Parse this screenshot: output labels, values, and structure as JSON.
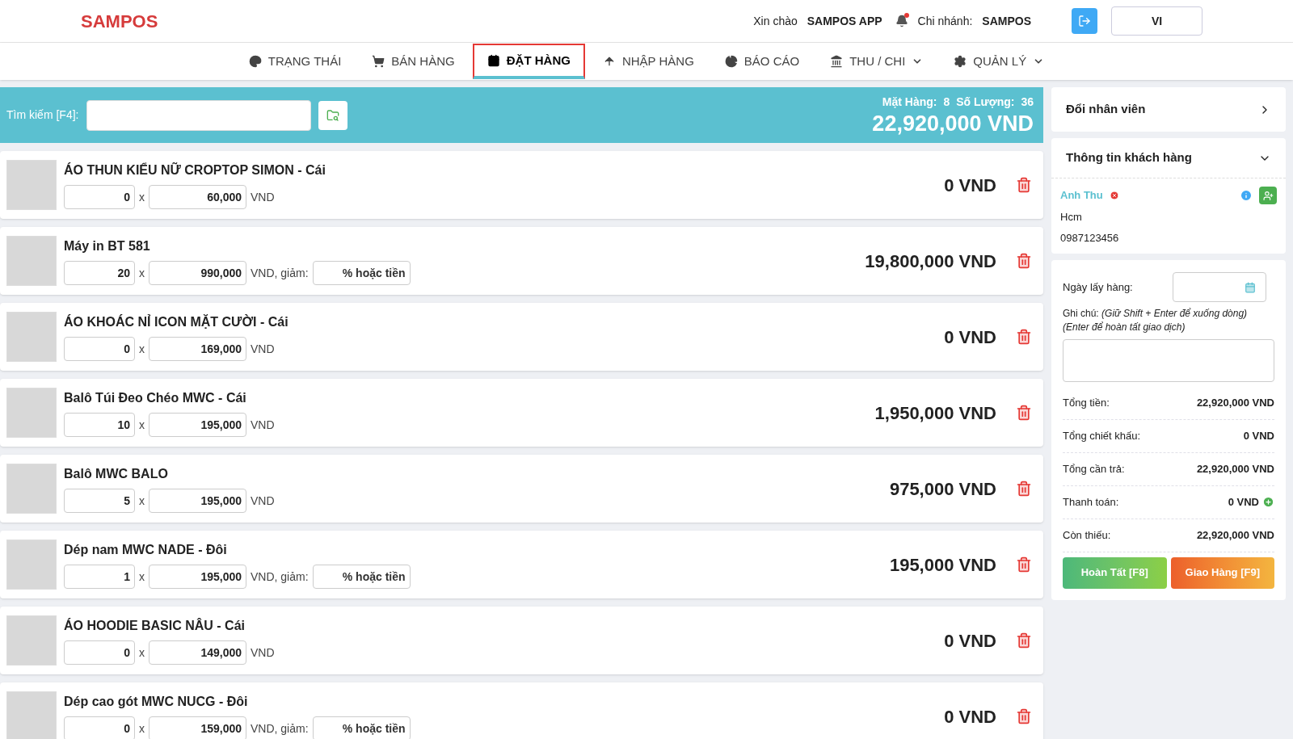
{
  "header": {
    "logo": "SAMPOS",
    "greeting": "Xin chào",
    "user": "SAMPOS APP",
    "branch_label": "Chi nhánh:",
    "branch": "SAMPOS",
    "notification": true,
    "language": "VI"
  },
  "nav": [
    {
      "label": "TRẠNG THÁI",
      "selected": false,
      "dropdown": false
    },
    {
      "label": "BÁN HÀNG",
      "selected": false,
      "dropdown": false
    },
    {
      "label": "ĐẶT HÀNG",
      "selected": true,
      "dropdown": false
    },
    {
      "label": "NHẬP HÀNG",
      "selected": false,
      "dropdown": false
    },
    {
      "label": "BÁO CÁO",
      "selected": false,
      "dropdown": false
    },
    {
      "label": "THU / CHI",
      "selected": false,
      "dropdown": true
    },
    {
      "label": "QUẢN LÝ",
      "selected": false,
      "dropdown": true
    }
  ],
  "search": {
    "label": "Tìm kiếm [F4]:",
    "items_label": "Mặt Hàng:",
    "items_count": "8",
    "qty_label": "Số Lượng:",
    "qty_count": "36",
    "total": "22,920,000 VND"
  },
  "items": [
    {
      "name": "ÁO THUN KIỂU NỮ CROPTOP SIMON - Cái",
      "qty": "0",
      "times": "x",
      "price": "60,000",
      "unit": "VND",
      "total": "0 VND"
    },
    {
      "name": "Máy in BT 581",
      "qty": "20",
      "times": "x",
      "price": "990,000",
      "unit": "VND, giảm:",
      "discount_placeholder": "% hoặc tiền",
      "total": "19,800,000 VND"
    },
    {
      "name": "ÁO KHOÁC NỈ ICON MẶT CƯỜI - Cái",
      "qty": "0",
      "times": "x",
      "price": "169,000",
      "unit": "VND",
      "total": "0 VND"
    },
    {
      "name": "Balô Túi Đeo Chéo MWC - Cái",
      "qty": "10",
      "times": "x",
      "price": "195,000",
      "unit": "VND",
      "total": "1,950,000 VND"
    },
    {
      "name": "Balô MWC BALO",
      "qty": "5",
      "times": "x",
      "price": "195,000",
      "unit": "VND",
      "total": "975,000 VND"
    },
    {
      "name": "Dép nam MWC NADE - Đôi",
      "qty": "1",
      "times": "x",
      "price": "195,000",
      "unit": "VND, giảm:",
      "discount_placeholder": "% hoặc tiền",
      "total": "195,000 VND"
    },
    {
      "name": "ÁO HOODIE BASIC NÂU - Cái",
      "qty": "0",
      "times": "x",
      "price": "149,000",
      "unit": "VND",
      "total": "0 VND"
    },
    {
      "name": "Dép cao gót MWC NUCG - Đôi",
      "qty": "0",
      "times": "x",
      "price": "159,000",
      "unit": "VND, giảm:",
      "discount_placeholder": "% hoặc tiền",
      "total": "0 VND"
    }
  ],
  "staff": {
    "title": "Đổi nhân viên"
  },
  "customer": {
    "title": "Thông tin khách hàng",
    "name": "Anh Thu",
    "address": "Hcm",
    "phone": "0987123456"
  },
  "order": {
    "pickup_label": "Ngày lấy hàng:",
    "note_label": "Ghi chú:",
    "note_hint": "(Giữ Shift + Enter để xuống dòng)",
    "note_hint2": "(Enter để hoàn tất giao dịch)",
    "summary": [
      {
        "label": "Tổng tiền:",
        "value": "22,920,000 VND",
        "add": false
      },
      {
        "label": "Tổng chiết khấu:",
        "value": "0 VND",
        "add": false
      },
      {
        "label": "Tổng cần trả:",
        "value": "22,920,000 VND",
        "add": false
      },
      {
        "label": "Thanh toán:",
        "value": "0 VND",
        "add": true
      },
      {
        "label": "Còn thiếu:",
        "value": "22,920,000 VND",
        "add": false
      }
    ],
    "buttons": [
      {
        "kind": "complete",
        "label": "Hoàn Tất [F8]"
      },
      {
        "kind": "deliver",
        "label": "Giao Hàng [F9]"
      }
    ]
  }
}
